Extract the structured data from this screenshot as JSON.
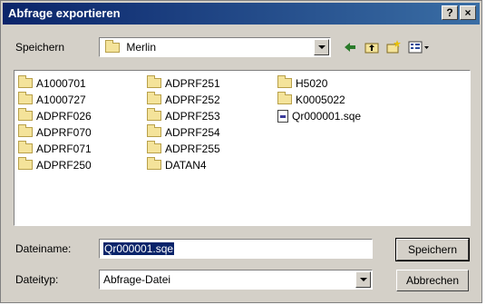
{
  "window": {
    "title": "Abfrage exportieren",
    "help_label": "?",
    "close_label": "×"
  },
  "save_in": {
    "label": "Speichern",
    "value": "Merlin"
  },
  "toolbar": {
    "icons": [
      "back-arrow-icon",
      "up-one-level-icon",
      "new-folder-icon",
      "view-menu-icon"
    ]
  },
  "files": {
    "col1": [
      "A1000701",
      "A1000727",
      "ADPRF026",
      "ADPRF070",
      "ADPRF071",
      "ADPRF250"
    ],
    "col2": [
      "ADPRF251",
      "ADPRF252",
      "ADPRF253",
      "ADPRF254",
      "ADPRF255",
      "DATAN4"
    ],
    "col3_folders": [
      "H5020",
      "K0005022"
    ],
    "col3_file": "Qr000001.sqe"
  },
  "filename": {
    "label": "Dateiname:",
    "value": "Qr000001.sqe"
  },
  "filetype": {
    "label": "Dateityp:",
    "value": "Abfrage-Datei"
  },
  "buttons": {
    "save": "Speichern",
    "cancel": "Abbrechen"
  }
}
